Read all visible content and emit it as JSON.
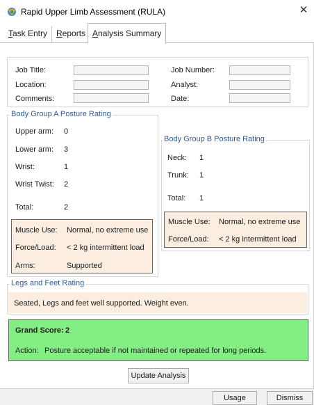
{
  "window": {
    "title": "Rapid Upper Limb Assessment (RULA)",
    "close_glyph": "✕"
  },
  "tabs": [
    {
      "label": "Task Entry",
      "underline": "T",
      "rest": "ask Entry",
      "active": false
    },
    {
      "label": "Reports",
      "underline": "R",
      "rest": "eports",
      "active": false
    },
    {
      "label": "Analysis Summary",
      "underline": "A",
      "rest": "nalysis Summary",
      "active": true
    }
  ],
  "job_info": {
    "job_title_label": "Job Title:",
    "location_label": "Location:",
    "comments_label": "Comments:",
    "job_number_label": "Job Number:",
    "analyst_label": "Analyst:",
    "date_label": "Date:",
    "job_title_value": "",
    "location_value": "",
    "comments_value": "",
    "job_number_value": "",
    "analyst_value": "",
    "date_value": ""
  },
  "group_a": {
    "title": "Body Group A Posture Rating",
    "rows": [
      {
        "label": "Upper arm:",
        "value": "0"
      },
      {
        "label": "Lower arm:",
        "value": "3"
      },
      {
        "label": "Wrist:",
        "value": "1"
      },
      {
        "label": "Wrist Twist:",
        "value": "2"
      }
    ],
    "total_label": "Total:",
    "total_value": "2",
    "muscle_use_label": "Muscle Use:",
    "muscle_use_value": "Normal, no extreme use",
    "force_load_label": "Force/Load:",
    "force_load_value": "< 2 kg intermittent load",
    "arms_label": "Arms:",
    "arms_value": "Supported"
  },
  "group_b": {
    "title": "Body Group B Posture Rating",
    "rows": [
      {
        "label": "Neck:",
        "value": "1"
      },
      {
        "label": "Trunk:",
        "value": "1"
      }
    ],
    "total_label": "Total:",
    "total_value": "1",
    "muscle_use_label": "Muscle Use:",
    "muscle_use_value": "Normal, no extreme use",
    "force_load_label": "Force/Load:",
    "force_load_value": "< 2 kg intermittent load"
  },
  "legs": {
    "title": "Legs and Feet Rating",
    "text": "Seated, Legs and feet well supported.  Weight even."
  },
  "grand": {
    "score_label": "Grand Score:",
    "score_value": "2",
    "action_label": "Action:",
    "action_text": "Posture acceptable if not maintained or repeated for long periods."
  },
  "buttons": {
    "update": "Update Analysis",
    "usage": "Usage",
    "dismiss": "Dismiss"
  },
  "colors": {
    "group_title": "#2c5aa0",
    "peach": "#fbeee0",
    "green": "#84ee84"
  }
}
